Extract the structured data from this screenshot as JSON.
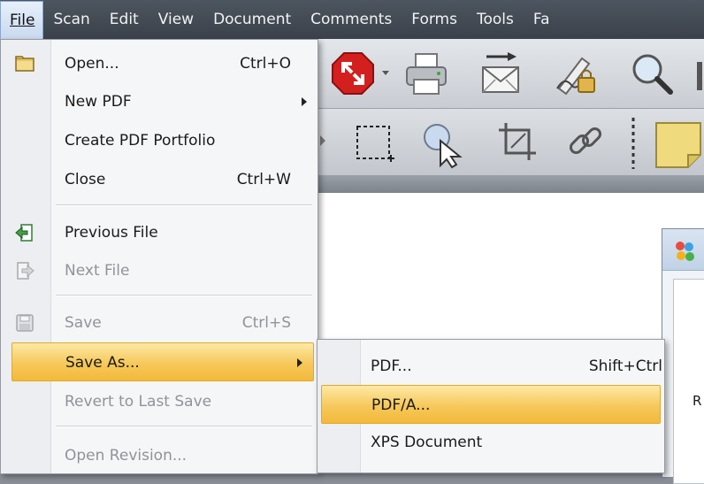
{
  "menubar": {
    "items": [
      {
        "label": "File"
      },
      {
        "label": "Scan"
      },
      {
        "label": "Edit"
      },
      {
        "label": "View"
      },
      {
        "label": "Document"
      },
      {
        "label": "Comments"
      },
      {
        "label": "Forms"
      },
      {
        "label": "Tools"
      },
      {
        "label": "Fa"
      }
    ]
  },
  "file_menu": {
    "open": {
      "label": "Open...",
      "shortcut": "Ctrl+O"
    },
    "new_pdf": {
      "label": "New PDF"
    },
    "create_portfolio": {
      "label": "Create PDF Portfolio"
    },
    "close": {
      "label": "Close",
      "shortcut": "Ctrl+W"
    },
    "previous_file": {
      "label": "Previous File"
    },
    "next_file": {
      "label": "Next File"
    },
    "save": {
      "label": "Save",
      "shortcut": "Ctrl+S"
    },
    "save_as": {
      "label": "Save As..."
    },
    "revert": {
      "label": "Revert to Last Save"
    },
    "open_revision": {
      "label": "Open Revision..."
    }
  },
  "save_as_menu": {
    "pdf": {
      "label": "PDF...",
      "shortcut": "Shift+Ctrl"
    },
    "pdfa": {
      "label": "PDF/A..."
    },
    "xps": {
      "label": "XPS Document"
    }
  },
  "dialog": {
    "partial_text": "R"
  },
  "colors": {
    "highlight": "#f6c85a",
    "menubar": "#3a414a"
  }
}
